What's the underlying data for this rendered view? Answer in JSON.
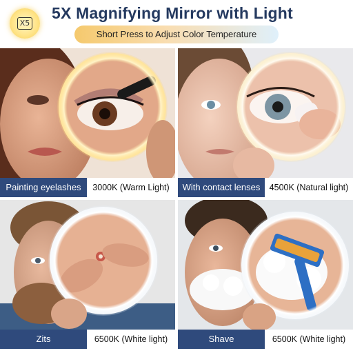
{
  "header": {
    "badge_label": "X5",
    "title": "5X Magnifying Mirror with Light",
    "subtitle": "Short Press to Adjust Color Temperature"
  },
  "panels": [
    {
      "scene": "Painting eyelashes",
      "temperature": "3000K  (Warm Light)",
      "photo_subject": "woman-applying-mascara",
      "light_color": "#ffe7a6"
    },
    {
      "scene": "With contact lenses",
      "temperature": "4500K (Natural light)",
      "photo_subject": "woman-inserting-contact-lens",
      "light_color": "#fff6dc"
    },
    {
      "scene": "Zits",
      "temperature": "6500K (White light)",
      "photo_subject": "man-examining-skin",
      "light_color": "#ffffff"
    },
    {
      "scene": "Shave",
      "temperature": "6500K (White light)",
      "photo_subject": "man-shaving-with-razor",
      "light_color": "#ffffff"
    }
  ],
  "colors": {
    "title": "#24395f",
    "caption_bar": "#2f4a7c",
    "badge": "#f6cf5a"
  }
}
